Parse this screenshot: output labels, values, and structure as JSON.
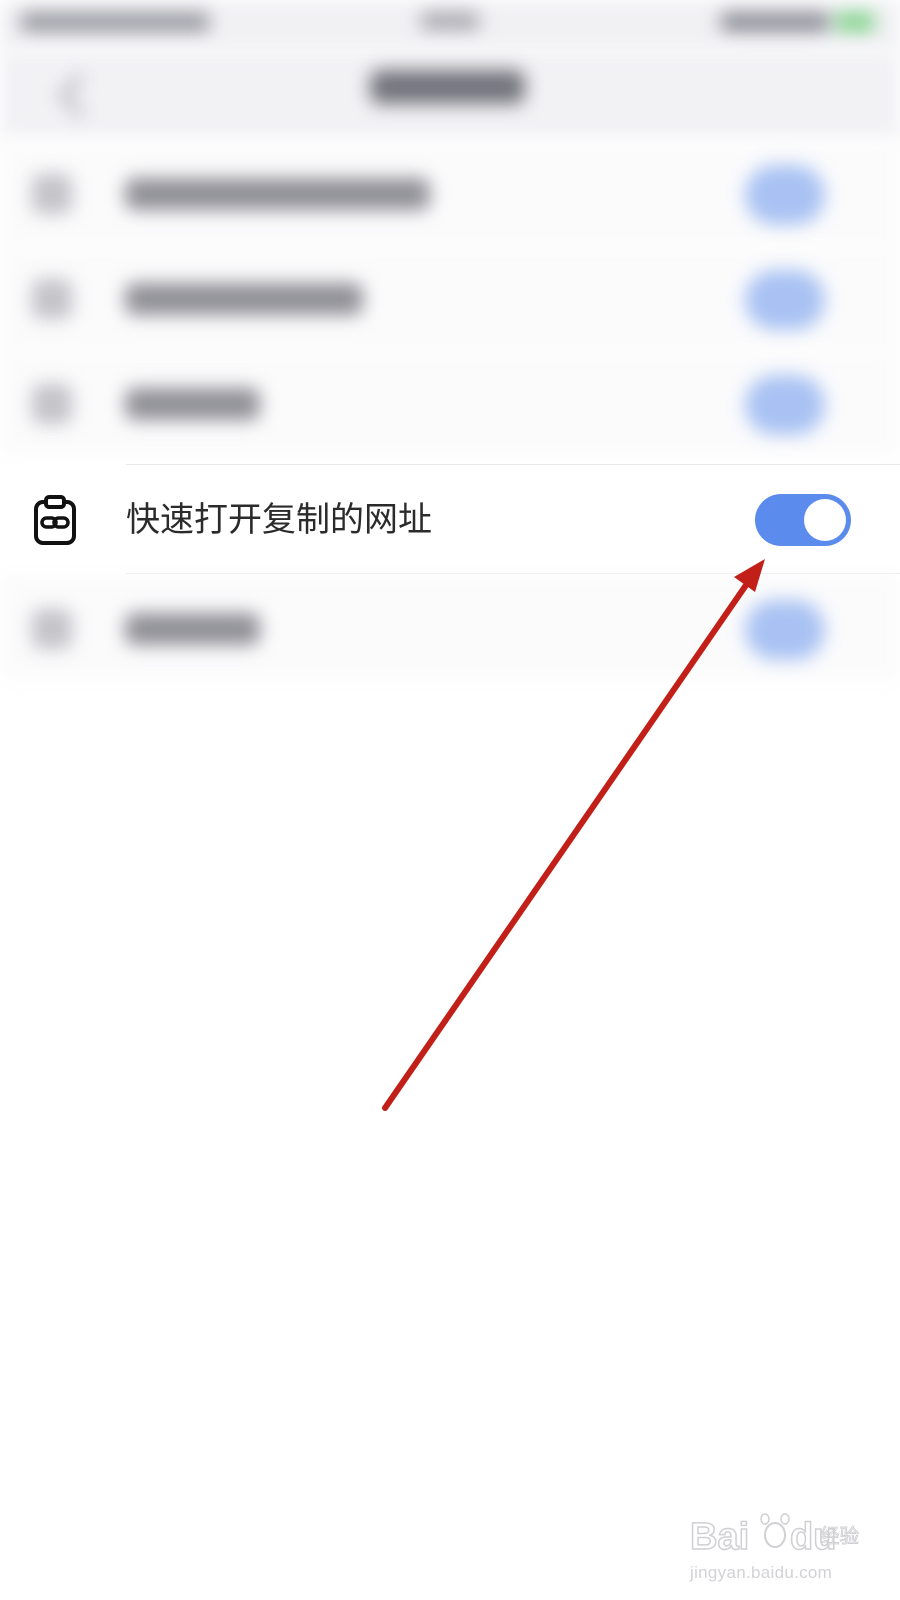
{
  "settings_row": {
    "label": "快速打开复制的网址",
    "icon": "clipboard-link-icon",
    "toggle_state": "on"
  },
  "colors": {
    "toggle_on": "#5b8ced",
    "annotation_arrow": "#c21f18",
    "label_text": "#2b2b2b"
  },
  "watermark": {
    "brand": "Baidu经验",
    "url": "jingyan.baidu.com"
  }
}
